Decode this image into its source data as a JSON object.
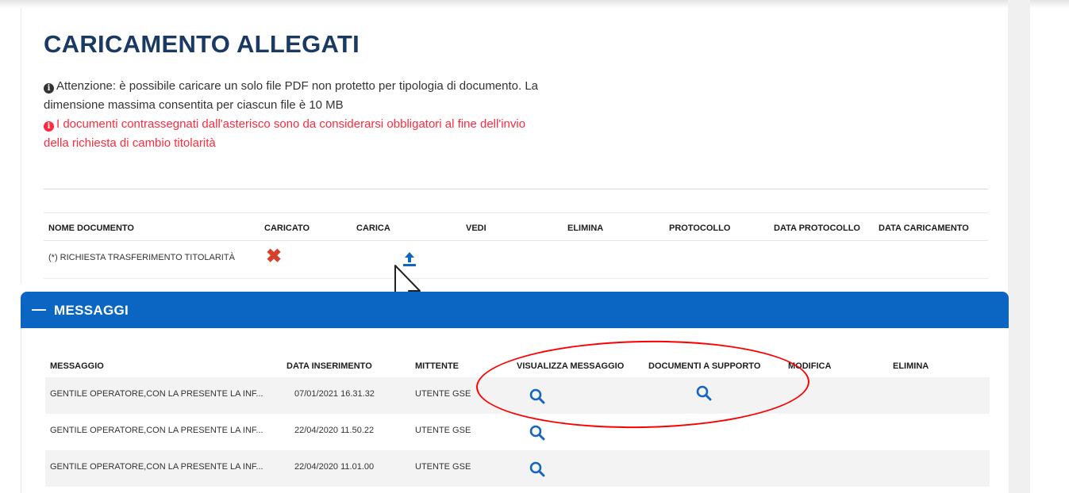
{
  "allegati": {
    "title": "CARICAMENTO ALLEGATI",
    "notice1": "Attenzione: è possibile caricare un solo file PDF non protetto per tipologia di documento. La dimensione massima consentita per ciascun file è 10 MB",
    "notice2": "I documenti contrassegnati dall'asterisco sono da considerarsi obbligatori al fine dell'invio della richiesta di cambio titolarità",
    "columns": [
      "NOME DOCUMENTO",
      "CARICATO",
      "CARICA",
      "VEDI",
      "ELIMINA",
      "PROTOCOLLO",
      "DATA PROTOCOLLO",
      "DATA CARICAMENTO"
    ],
    "rows": [
      {
        "name": "(*) RICHIESTA TRASFERIMENTO TITOLARITÀ",
        "caricato_icon": "x-icon",
        "carica_icon": "upload-icon"
      }
    ]
  },
  "messaggi": {
    "title": "MESSAGGI",
    "toggle_icon": "minus-icon",
    "columns": [
      "MESSAGGIO",
      "DATA INSERIMENTO",
      "MITTENTE",
      "VISUALIZZA MESSAGGIO",
      "DOCUMENTI A SUPPORTO",
      "MODIFICA",
      "ELIMINA"
    ],
    "rows": [
      {
        "messaggio": "GENTILE OPERATORE,CON LA PRESENTE LA INF...",
        "data": "07/01/2021 16.31.32",
        "mittente": "UTENTE GSE"
      },
      {
        "messaggio": "GENTILE OPERATORE,CON LA PRESENTE LA INF...",
        "data": "22/04/2020 11.50.22",
        "mittente": "UTENTE GSE"
      },
      {
        "messaggio": "GENTILE OPERATORE,CON LA PRESENTE LA INF...",
        "data": "22/04/2020 11.01.00",
        "mittente": "UTENTE GSE"
      }
    ]
  },
  "colors": {
    "title": "#1a3a63",
    "warning": "#ff2a3d",
    "header_blue": "#0a66c2",
    "icon_blue": "#1565c0",
    "delete_red": "#d7412a",
    "annotation": "#ff0000"
  }
}
